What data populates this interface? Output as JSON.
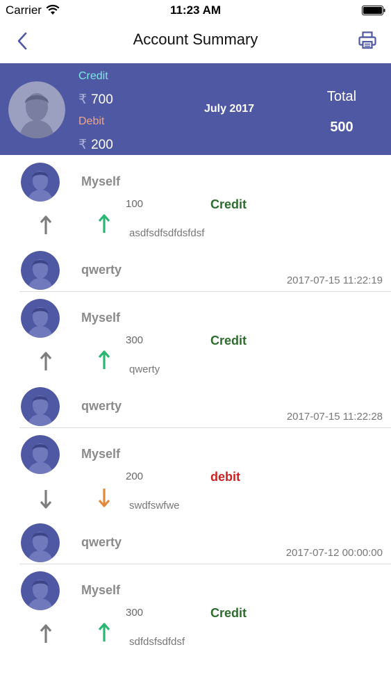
{
  "status_bar": {
    "carrier": "Carrier",
    "time": "11:23 AM"
  },
  "nav": {
    "title": "Account Summary",
    "back_icon": "chevron-left-icon",
    "print_icon": "printer-icon"
  },
  "summary": {
    "credit_label": "Credit",
    "credit_amount": "700",
    "debit_label": "Debit",
    "debit_amount": "200",
    "currency_symbol": "₹",
    "month": "July 2017",
    "total_label": "Total",
    "total_value": "500"
  },
  "colors": {
    "header_bg": "#4f58a3",
    "credit": "#2e6b2e",
    "debit": "#c92222",
    "arrow_up": "#2bb673",
    "arrow_down": "#e08a3c"
  },
  "transactions": [
    {
      "from": "Myself",
      "amount": "100",
      "type": "Credit",
      "direction": "up",
      "note": "asdfsdfsdfdsfdsf",
      "to": "qwerty",
      "datetime": "2017-07-15 11:22:19"
    },
    {
      "from": "Myself",
      "amount": "300",
      "type": "Credit",
      "direction": "up",
      "note": "qwerty",
      "to": "qwerty",
      "datetime": "2017-07-15 11:22:28"
    },
    {
      "from": "Myself",
      "amount": "200",
      "type": "debit",
      "direction": "down",
      "note": "swdfswfwe",
      "to": "qwerty",
      "datetime": "2017-07-12 00:00:00"
    },
    {
      "from": "Myself",
      "amount": "300",
      "type": "Credit",
      "direction": "up",
      "note": "sdfdsfsdfdsf",
      "to": "",
      "datetime": ""
    }
  ]
}
